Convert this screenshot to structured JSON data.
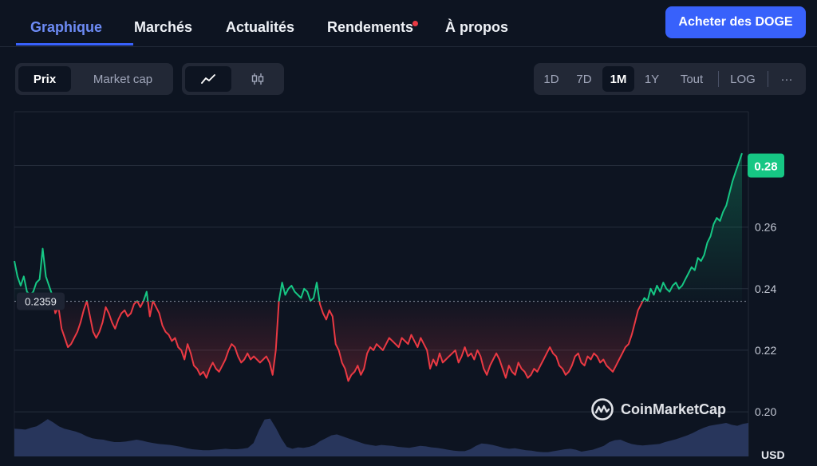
{
  "nav": {
    "tabs": [
      {
        "label": "Graphique",
        "active": true
      },
      {
        "label": "Marchés"
      },
      {
        "label": "Actualités"
      },
      {
        "label": "Rendements",
        "has_notification": true
      },
      {
        "label": "À propos"
      }
    ],
    "buy_label": "Acheter des DOGE"
  },
  "controls": {
    "metric": [
      {
        "label": "Prix",
        "active": true
      },
      {
        "label": "Market cap"
      }
    ],
    "chart_style": [
      {
        "icon": "line-chart-icon",
        "active": true
      },
      {
        "icon": "candlestick-icon"
      }
    ],
    "ranges": [
      {
        "label": "1D"
      },
      {
        "label": "7D"
      },
      {
        "label": "1M",
        "active": true
      },
      {
        "label": "1Y"
      },
      {
        "label": "Tout"
      }
    ],
    "log_label": "LOG",
    "more_label": "···"
  },
  "watermark": "CoinMarketCap",
  "colors": {
    "background": "#0d1421",
    "accent": "#3861fb",
    "up": "#16c784",
    "down": "#ea3943",
    "volume": "#2b3a63"
  },
  "chart_data": {
    "type": "line",
    "y_ticks": [
      "0.28",
      "0.26",
      "0.24",
      "0.22",
      "0.20"
    ],
    "ylim": [
      0.1855,
      0.2975
    ],
    "y_unit": "USD",
    "reference_value": 0.2359,
    "reference_label": "0.2359",
    "current_price": 0.28,
    "current_label": "0.28",
    "grid": true,
    "series": [
      {
        "values": [
          0.249,
          0.244,
          0.241,
          0.244,
          0.239,
          0.238,
          0.239,
          0.242,
          0.243,
          0.253,
          0.244,
          0.241,
          0.238,
          0.232,
          0.234,
          0.227,
          0.224,
          0.221,
          0.222,
          0.224,
          0.226,
          0.229,
          0.233,
          0.236,
          0.231,
          0.226,
          0.224,
          0.226,
          0.229,
          0.234,
          0.232,
          0.229,
          0.227,
          0.23,
          0.232,
          0.233,
          0.231,
          0.232,
          0.235,
          0.236,
          0.234,
          0.236,
          0.239,
          0.231,
          0.236,
          0.234,
          0.232,
          0.228,
          0.226,
          0.225,
          0.223,
          0.224,
          0.221,
          0.22,
          0.217,
          0.222,
          0.219,
          0.215,
          0.214,
          0.212,
          0.213,
          0.211,
          0.214,
          0.216,
          0.214,
          0.213,
          0.215,
          0.217,
          0.22,
          0.222,
          0.221,
          0.218,
          0.216,
          0.217,
          0.219,
          0.217,
          0.218,
          0.217,
          0.216,
          0.217,
          0.218,
          0.216,
          0.212,
          0.22,
          0.236,
          0.242,
          0.238,
          0.24,
          0.241,
          0.239,
          0.238,
          0.237,
          0.24,
          0.239,
          0.236,
          0.237,
          0.242,
          0.235,
          0.232,
          0.23,
          0.233,
          0.231,
          0.222,
          0.22,
          0.216,
          0.214,
          0.21,
          0.212,
          0.213,
          0.215,
          0.212,
          0.214,
          0.219,
          0.221,
          0.22,
          0.222,
          0.221,
          0.22,
          0.222,
          0.224,
          0.223,
          0.222,
          0.221,
          0.224,
          0.223,
          0.222,
          0.225,
          0.223,
          0.221,
          0.224,
          0.222,
          0.22,
          0.214,
          0.217,
          0.215,
          0.219,
          0.216,
          0.217,
          0.218,
          0.219,
          0.22,
          0.216,
          0.218,
          0.221,
          0.218,
          0.219,
          0.217,
          0.22,
          0.218,
          0.214,
          0.212,
          0.215,
          0.217,
          0.219,
          0.217,
          0.214,
          0.211,
          0.215,
          0.213,
          0.212,
          0.216,
          0.214,
          0.213,
          0.211,
          0.212,
          0.214,
          0.213,
          0.215,
          0.217,
          0.219,
          0.221,
          0.219,
          0.218,
          0.215,
          0.214,
          0.212,
          0.213,
          0.215,
          0.218,
          0.219,
          0.216,
          0.215,
          0.218,
          0.217,
          0.219,
          0.218,
          0.216,
          0.217,
          0.215,
          0.214,
          0.213,
          0.215,
          0.217,
          0.219,
          0.221,
          0.222,
          0.225,
          0.229,
          0.233,
          0.235,
          0.237,
          0.236,
          0.24,
          0.238,
          0.241,
          0.239,
          0.242,
          0.24,
          0.239,
          0.241,
          0.242,
          0.24,
          0.241,
          0.243,
          0.245,
          0.247,
          0.246,
          0.25,
          0.249,
          0.251,
          0.255,
          0.257,
          0.261,
          0.263,
          0.262,
          0.265,
          0.267,
          0.271,
          0.275,
          0.278,
          0.281,
          0.284
        ]
      }
    ],
    "volume": [
      0.58,
      0.57,
      0.56,
      0.6,
      0.63,
      0.7,
      0.78,
      0.71,
      0.63,
      0.58,
      0.55,
      0.52,
      0.48,
      0.42,
      0.38,
      0.36,
      0.35,
      0.32,
      0.3,
      0.3,
      0.31,
      0.33,
      0.35,
      0.33,
      0.3,
      0.28,
      0.26,
      0.25,
      0.24,
      0.22,
      0.2,
      0.17,
      0.15,
      0.14,
      0.13,
      0.13,
      0.14,
      0.15,
      0.16,
      0.15,
      0.15,
      0.16,
      0.18,
      0.28,
      0.55,
      0.77,
      0.79,
      0.6,
      0.38,
      0.2,
      0.16,
      0.19,
      0.18,
      0.2,
      0.24,
      0.32,
      0.38,
      0.44,
      0.46,
      0.42,
      0.38,
      0.34,
      0.3,
      0.26,
      0.24,
      0.22,
      0.24,
      0.23,
      0.22,
      0.2,
      0.19,
      0.18,
      0.2,
      0.22,
      0.21,
      0.19,
      0.18,
      0.16,
      0.14,
      0.12,
      0.11,
      0.11,
      0.15,
      0.22,
      0.27,
      0.26,
      0.24,
      0.21,
      0.18,
      0.16,
      0.17,
      0.15,
      0.13,
      0.12,
      0.1,
      0.09,
      0.09,
      0.11,
      0.13,
      0.15,
      0.16,
      0.14,
      0.1,
      0.12,
      0.14,
      0.18,
      0.22,
      0.3,
      0.34,
      0.35,
      0.3,
      0.26,
      0.24,
      0.23,
      0.24,
      0.25,
      0.26,
      0.3,
      0.33,
      0.36,
      0.4,
      0.44,
      0.49,
      0.55,
      0.6,
      0.64,
      0.66,
      0.68,
      0.7,
      0.66,
      0.64,
      0.68,
      0.7
    ]
  }
}
